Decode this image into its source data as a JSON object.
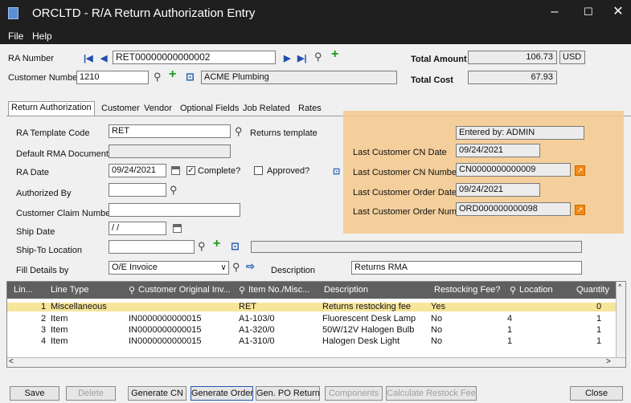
{
  "window": {
    "title": "ORCLTD - R/A Return Authorization Entry",
    "minimize": "–",
    "maximize": "☐",
    "close": "✕"
  },
  "menu": {
    "file": "File",
    "help": "Help"
  },
  "header": {
    "ra_number_label": "RA Number",
    "ra_number": "RET00000000000002",
    "customer_number_label": "Customer Number",
    "customer_number": "1210",
    "customer_name": "ACME Plumbing",
    "total_amount_label": "Total Amount",
    "total_amount": "106.73",
    "currency": "USD",
    "total_cost_label": "Total Cost",
    "total_cost": "67.93"
  },
  "tabs": [
    "Return Authorization",
    "Customer",
    "Vendor",
    "Optional Fields",
    "Job Related",
    "Rates"
  ],
  "form": {
    "ra_template_code_label": "RA Template Code",
    "ra_template_code": "RET",
    "template_desc": "Returns template",
    "default_rma_label": "Default RMA Document",
    "default_rma": "",
    "ra_date_label": "RA Date",
    "ra_date": "09/24/2021",
    "complete_label": "Complete?",
    "approved_label": "Approved?",
    "authorized_by_label": "Authorized By",
    "authorized_by": "",
    "customer_claim_label": "Customer Claim Number",
    "customer_claim": "",
    "ship_date_label": "Ship Date",
    "ship_date": "/ /",
    "ship_to_label": "Ship-To Location",
    "ship_to": "",
    "fill_details_label": "Fill Details by",
    "fill_details": "O/E Invoice",
    "description_label": "Description",
    "description": "Returns RMA"
  },
  "panel": {
    "entered_by": "Entered by: ADMIN",
    "last_cn_date_label": "Last Customer CN Date",
    "last_cn_date": "09/24/2021",
    "last_cn_number_label": "Last Customer CN Number",
    "last_cn_number": "CN0000000000009",
    "last_order_date_label": "Last Customer Order Date",
    "last_order_date": "09/24/2021",
    "last_order_number_label": "Last Customer Order Number",
    "last_order_number": "ORD000000000098"
  },
  "grid": {
    "columns": [
      "Lin...",
      "Line Type",
      "Customer Original Inv...",
      "Item No./Misc...",
      "Description",
      "Restocking Fee?",
      "Location",
      "Quantity"
    ],
    "rows": [
      {
        "line": "1",
        "type": "Miscellaneous",
        "inv": "",
        "item": "RET",
        "desc": "Returns restocking fee",
        "fee": "Yes",
        "loc": "",
        "qty": "0"
      },
      {
        "line": "2",
        "type": "Item",
        "inv": "IN0000000000015",
        "item": "A1-103/0",
        "desc": "Fluorescent Desk Lamp",
        "fee": "No",
        "loc": "4",
        "qty": "1"
      },
      {
        "line": "3",
        "type": "Item",
        "inv": "IN0000000000015",
        "item": "A1-320/0",
        "desc": "50W/12V Halogen Bulb",
        "fee": "No",
        "loc": "1",
        "qty": "1"
      },
      {
        "line": "4",
        "type": "Item",
        "inv": "IN0000000000015",
        "item": "A1-310/0",
        "desc": "Halogen Desk Light",
        "fee": "No",
        "loc": "1",
        "qty": "1"
      }
    ]
  },
  "buttons": {
    "save": "Save",
    "delete": "Delete",
    "generate_cn": "Generate CN",
    "generate_order": "Generate Order",
    "gen_po_return": "Gen. PO Return",
    "components": "Components",
    "calc_restock": "Calculate Restock Fee",
    "close": "Close"
  }
}
